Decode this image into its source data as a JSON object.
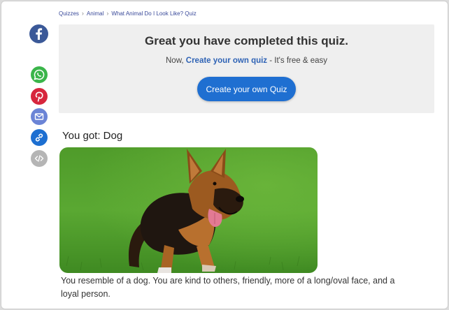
{
  "breadcrumb": {
    "items": [
      "Quizzes",
      "Animal",
      "What Animal Do I Look Like? Quiz"
    ],
    "separator": "›"
  },
  "share": [
    {
      "name": "facebook-icon",
      "color": "#3b5998"
    },
    {
      "name": "whatsapp-icon",
      "color": "#3ab54a"
    },
    {
      "name": "pinterest-icon",
      "color": "#d7263d"
    },
    {
      "name": "email-icon",
      "color": "#6b84d6"
    },
    {
      "name": "copy-link-icon",
      "color": "#1d6fd1"
    },
    {
      "name": "embed-icon",
      "color": "#b5b5b5"
    }
  ],
  "banner": {
    "title": "Great you have completed this quiz.",
    "sub_prefix": "Now, ",
    "sub_link": "Create your own quiz",
    "sub_suffix": " - It's free & easy",
    "cta_label": "Create your own Quiz"
  },
  "result": {
    "heading": "You got: Dog",
    "image_subject": "german-shepherd-dog-running-on-grass",
    "description": "You resemble of a dog. You are kind to others, friendly, more of a long/oval face, and a loyal person."
  },
  "colors": {
    "accent": "#1f6fd1",
    "link": "#2f63b5",
    "banner_bg": "#efefef"
  }
}
